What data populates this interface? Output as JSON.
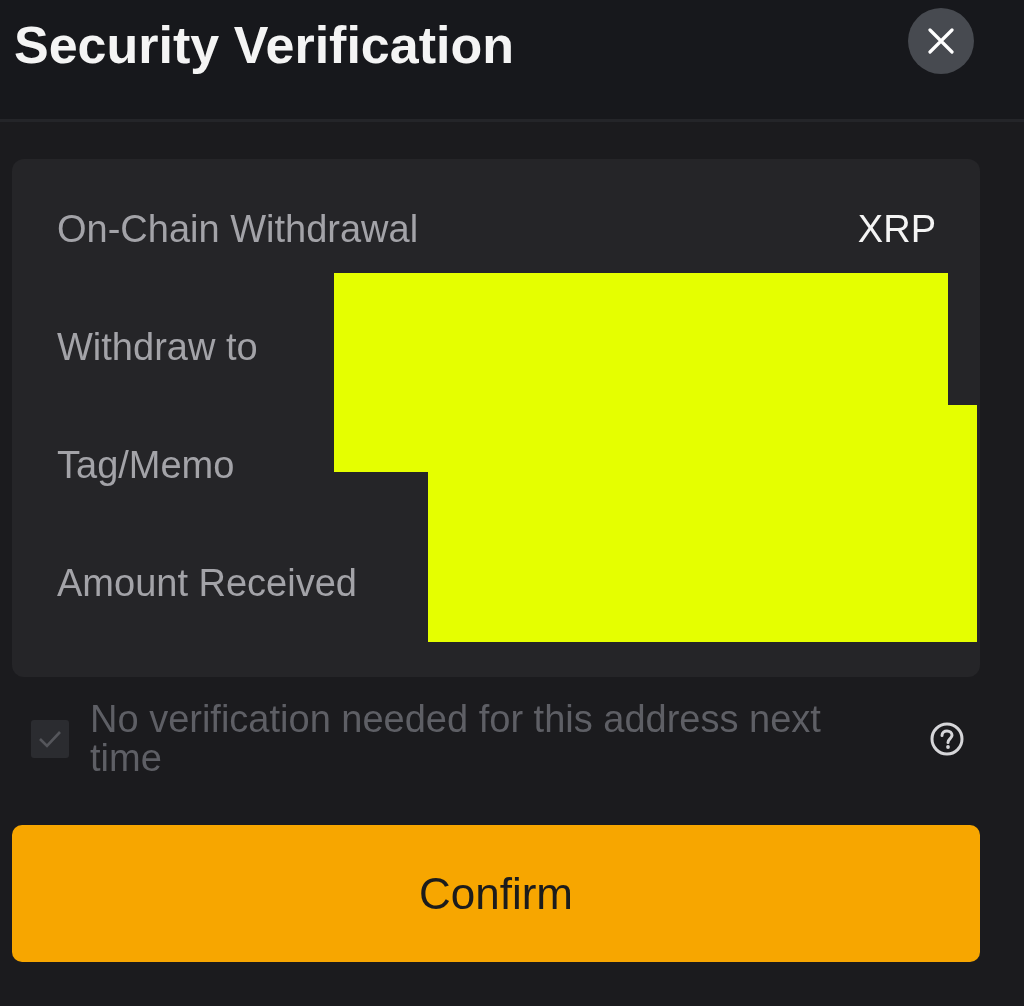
{
  "header": {
    "title": "Security Verification"
  },
  "details": {
    "rows": [
      {
        "label": "On-Chain Withdrawal",
        "value": "XRP"
      },
      {
        "label": "Withdraw to"
      },
      {
        "label": "Tag/Memo"
      },
      {
        "label": "Amount Received"
      }
    ]
  },
  "remember_option": {
    "label": "No verification needed for this address next time",
    "checked": true,
    "disabled": true
  },
  "confirm_button": {
    "label": "Confirm"
  }
}
